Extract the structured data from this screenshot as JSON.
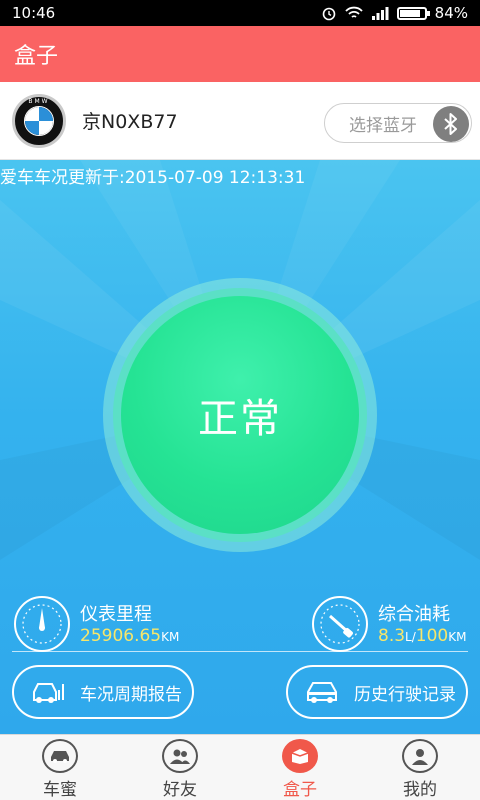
{
  "status_bar": {
    "time": "10:46",
    "battery": "84%",
    "battery_level": 0.84
  },
  "app_bar": {
    "title": "盒子"
  },
  "car": {
    "brand_badge": "BMW",
    "plate": "京N0XB77",
    "bluetooth_placeholder": "选择蓝牙"
  },
  "update": {
    "text": "爱车车况更新于:2015-07-09 12:13:31"
  },
  "status": {
    "label": "正常",
    "color": "#25e394"
  },
  "stats": {
    "mileage": {
      "label": "仪表里程",
      "value": "25906.65",
      "unit": "KM"
    },
    "fuel": {
      "label": "综合油耗",
      "value": "8.3",
      "unit_small": "L/",
      "value2": "100",
      "unit": "KM"
    }
  },
  "actions": {
    "report": "车况周期报告",
    "history": "历史行驶记录"
  },
  "tabs": [
    {
      "label": "车蜜",
      "icon": "car-icon"
    },
    {
      "label": "好友",
      "icon": "friends-icon"
    },
    {
      "label": "盒子",
      "icon": "box-icon",
      "active": true
    },
    {
      "label": "我的",
      "icon": "person-icon"
    }
  ],
  "colors": {
    "accent": "#fa6363",
    "main_bg": "#34b2ee",
    "value_yellow": "#f7e66a"
  }
}
